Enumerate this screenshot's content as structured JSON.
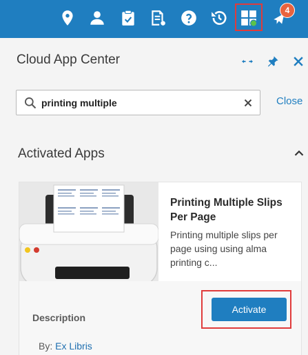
{
  "topbar": {
    "icons": [
      "location-icon",
      "user-icon",
      "clipboard-icon",
      "document-list-icon",
      "help-icon",
      "history-icon",
      "apps-icon",
      "announcements-icon"
    ],
    "notification_count": "4",
    "colors": {
      "background": "#1f7ec0",
      "highlight": "#e03b3b",
      "badge": "#e8633f",
      "status_dot": "#5cc24a"
    }
  },
  "panel": {
    "title": "Cloud App Center",
    "header_icons": [
      "expand-horizontal-icon",
      "pin-icon",
      "close-icon"
    ],
    "search": {
      "value": "printing multiple",
      "placeholder": ""
    },
    "close_label": "Close",
    "section_title": "Activated Apps"
  },
  "app_card": {
    "title": "Printing Multiple Slips Per Page",
    "description": "Printing multiple slips per page using using alma printing c...",
    "description_label": "Description",
    "by_prefix": "By: ",
    "author": "Ex Libris",
    "activate_label": "Activate"
  }
}
